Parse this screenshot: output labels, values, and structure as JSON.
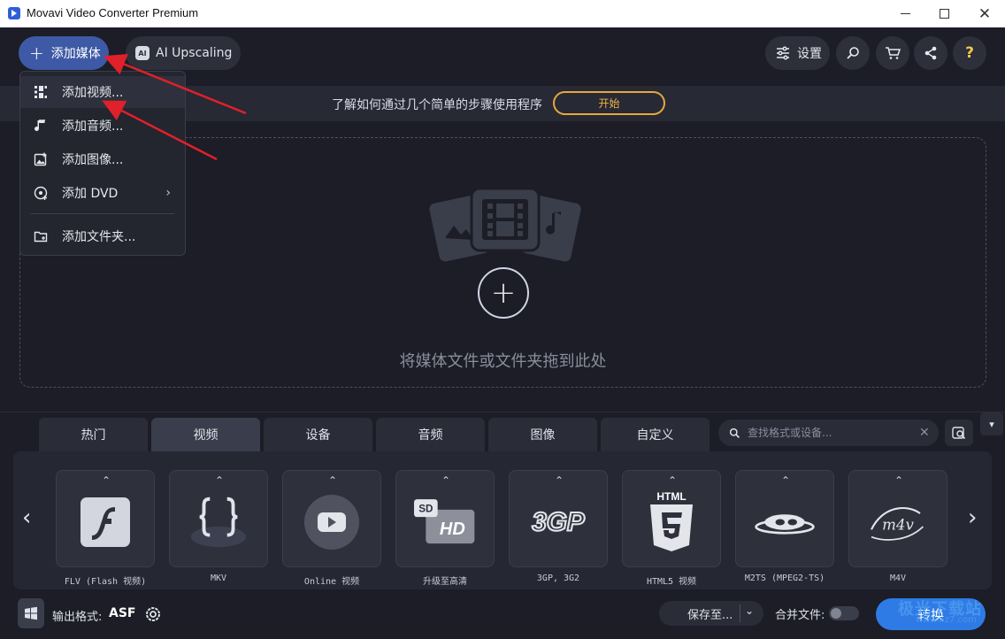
{
  "window": {
    "title": "Movavi Video Converter Premium"
  },
  "toolbar": {
    "add_media_label": "添加媒体",
    "ai_upscaling_label": "AI Upscaling",
    "ai_icon_text": "AI",
    "settings_label": "设置",
    "help_label": "?"
  },
  "hint": {
    "text": "了解如何通过几个简单的步骤使用程序",
    "start_label": "开始"
  },
  "add_menu": {
    "items": [
      {
        "label": "添加视频...",
        "icon": "video-add-icon",
        "active": true
      },
      {
        "label": "添加音频...",
        "icon": "music-note-icon"
      },
      {
        "label": "添加图像...",
        "icon": "image-add-icon"
      },
      {
        "label": "添加 DVD",
        "icon": "dvd-icon",
        "submenu": true
      },
      {
        "label": "添加文件夹...",
        "icon": "folder-add-icon"
      }
    ]
  },
  "drop_zone": {
    "text": "将媒体文件或文件夹拖到此处"
  },
  "format_tabs": [
    {
      "label": "热门"
    },
    {
      "label": "视频",
      "active": true
    },
    {
      "label": "设备"
    },
    {
      "label": "音频"
    },
    {
      "label": "图像"
    },
    {
      "label": "自定义"
    }
  ],
  "format_search": {
    "placeholder": "查找格式或设备..."
  },
  "formats": [
    {
      "label": "FLV (Flash 视频)",
      "logo": "flash-logo-icon"
    },
    {
      "label": "MKV",
      "logo": "mkv-logo-icon"
    },
    {
      "label": "Online 视频",
      "logo": "youtube-play-icon"
    },
    {
      "label": "升级至高清",
      "logo": "sd-hd-icon",
      "logo_text_a": "SD",
      "logo_text_b": "HD"
    },
    {
      "label": "3GP, 3G2",
      "logo": "3gp-logo-icon",
      "logo_text": "3GP"
    },
    {
      "label": "HTML5 视频",
      "logo": "html5-logo-icon",
      "logo_text": "HTML"
    },
    {
      "label": "M2TS (MPEG2-TS)",
      "logo": "bluray-logo-icon"
    },
    {
      "label": "M4V",
      "logo": "m4v-logo-icon",
      "logo_text": "m4v"
    }
  ],
  "footer": {
    "output_format_label": "输出格式:",
    "output_format_value": "ASF",
    "save_to_label": "保存至...",
    "merge_files_label": "合并文件:",
    "convert_label": "转换",
    "watermark_text": "极光下载站",
    "watermark_url": "www.xz7.com"
  },
  "colors": {
    "accent_blue": "#2f7be6",
    "add_button": "#3e5aa6",
    "start_outline": "#e8a83b",
    "annotation_red": "#e0202a"
  }
}
